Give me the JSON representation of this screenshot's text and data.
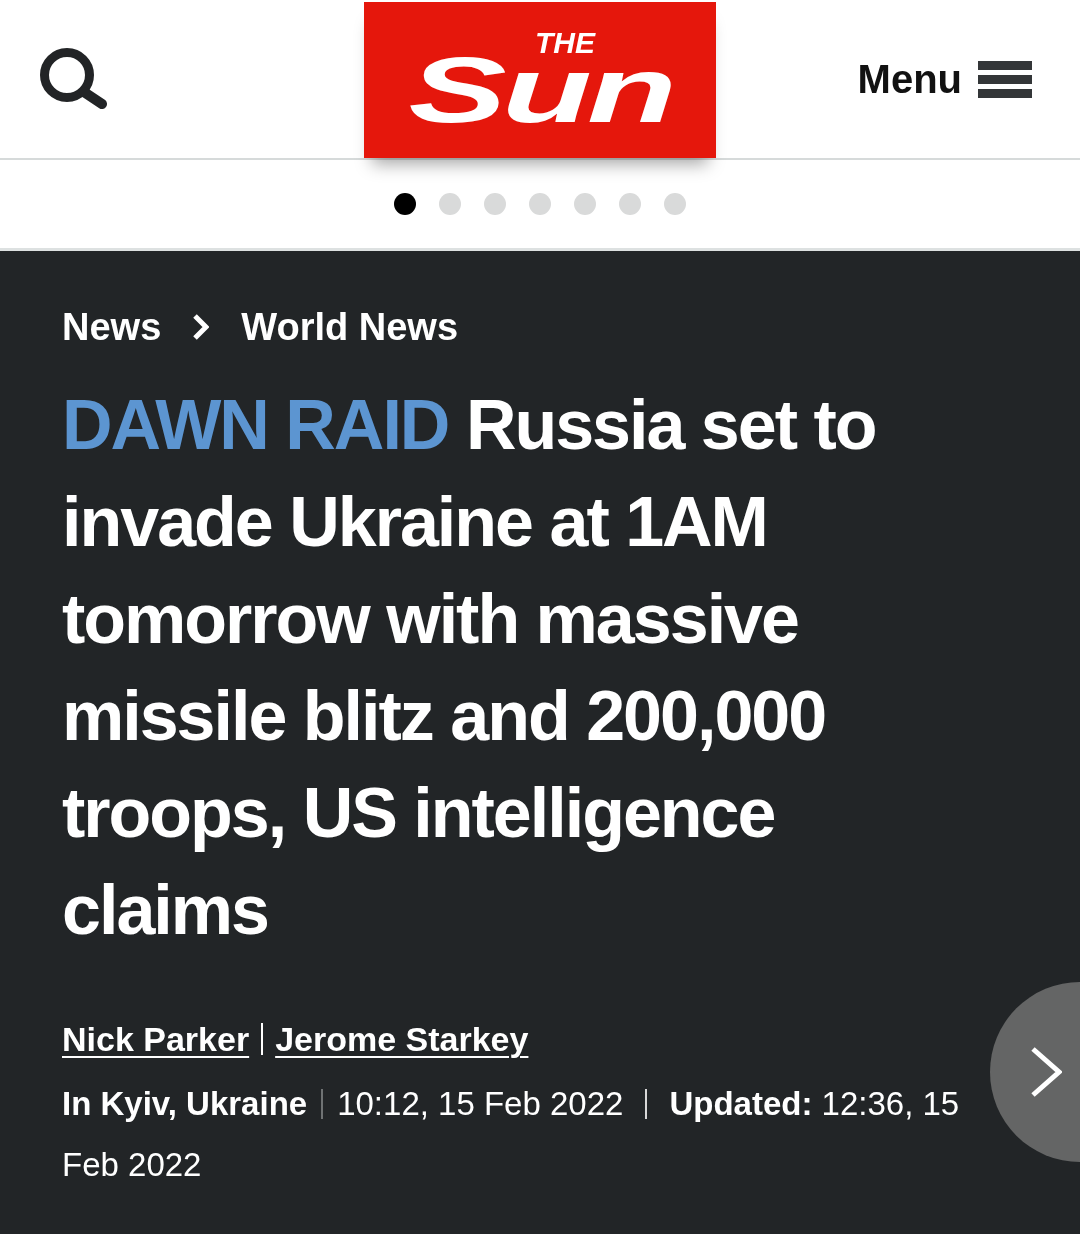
{
  "header": {
    "logo": {
      "small_text": "THE",
      "wordmark": "Sun"
    },
    "menu_label": "Menu"
  },
  "carousel_dots": [
    {
      "selected": true
    },
    {
      "selected": false
    },
    {
      "selected": false
    },
    {
      "selected": false
    },
    {
      "selected": false
    },
    {
      "selected": false
    },
    {
      "selected": false
    }
  ],
  "breadcrumb": [
    "News",
    "World News"
  ],
  "article": {
    "kicker": "DAWN RAID",
    "headline": "Russia set to invade Ukraine at 1AM tomorrow with massive missile blitz and 200,000 troops, US intelligence claims",
    "authors": [
      "Nick Parker",
      "Jerome Starkey"
    ],
    "location": "In Kyiv, Ukraine",
    "published": "10:12, 15 Feb 2022",
    "updated": "**Updated:** 12:36, 15 Feb 2022"
  }
}
